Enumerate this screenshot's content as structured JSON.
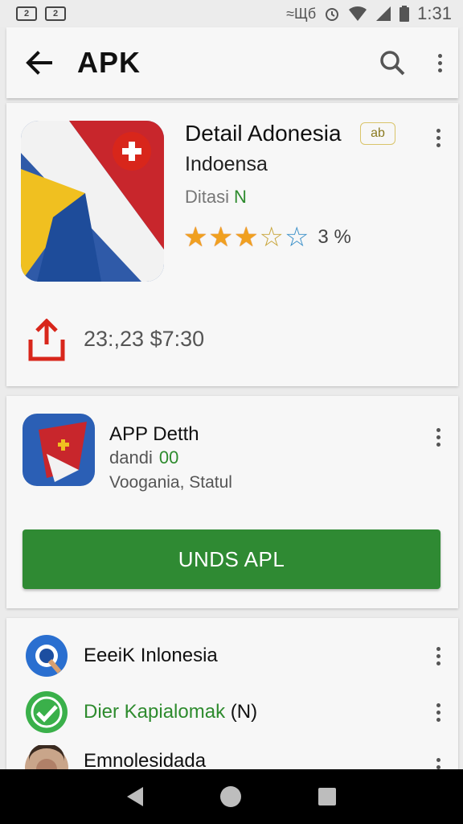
{
  "status_bar": {
    "notif_a": "2",
    "notif_b": "2",
    "signal_text": "≈Щб",
    "time": "1:31"
  },
  "app_bar": {
    "back_icon": "arrow-left-icon",
    "title": "APK",
    "search_icon": "search-icon",
    "more_icon": "more-vert-icon"
  },
  "detail_card": {
    "title": "Detail Adonesia",
    "badge": "ab",
    "subtitle": "Indoensa",
    "category": "Ditasi",
    "category_accent": "N",
    "rating_filled": 3,
    "rating_max": 5,
    "rating_text": "3  %",
    "share_icon": "share-icon",
    "price_text": "23:,23 $7:30"
  },
  "app_card": {
    "title": "APP Detth",
    "line2": "dandi",
    "line2_accent": "00",
    "line3": "Voogania, Statul",
    "button_label": "UNDS APL"
  },
  "list": {
    "items": [
      {
        "label": "EeeiK Inlonesia",
        "icon": "lens-app-icon",
        "green": false
      },
      {
        "label": "Dier Kapialomak",
        "suffix": " (N)",
        "icon": "check-app-icon",
        "green": true
      },
      {
        "label": "Emnolesidada",
        "icon": "avatar-icon",
        "green": false
      }
    ]
  },
  "nav_bar": {
    "back": "nav-back-icon",
    "home": "nav-home-icon",
    "recents": "nav-recents-icon"
  },
  "colors": {
    "accent_green": "#2f8a33",
    "star": "#f0a020",
    "share_red": "#d8261b"
  }
}
